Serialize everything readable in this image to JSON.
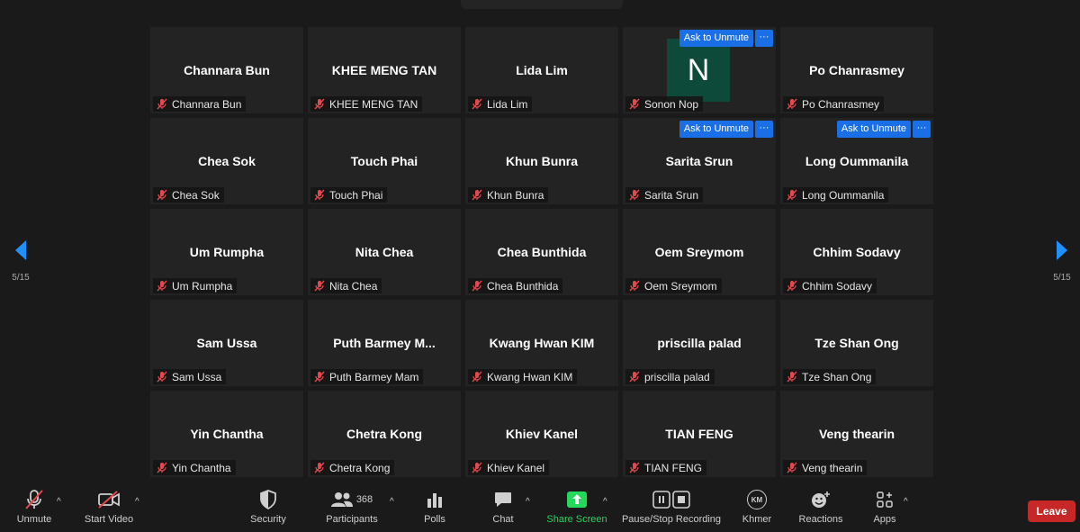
{
  "gallery": {
    "page_indicator_left": "5/15",
    "page_indicator_right": "5/15",
    "ask_to_unmute_label": "Ask to Unmute",
    "more_label": "···",
    "tiles": [
      {
        "name": "Channara Bun",
        "label": "Channara Bun"
      },
      {
        "name": "KHEE MENG TAN",
        "label": "KHEE MENG TAN"
      },
      {
        "name": "Lida Lim",
        "label": "Lida Lim"
      },
      {
        "name": "",
        "label": "Sonon Nop",
        "avatar_letter": "N",
        "ask_unmute": true
      },
      {
        "name": "Po Chanrasmey",
        "label": "Po Chanrasmey"
      },
      {
        "name": "Chea Sok",
        "label": "Chea Sok"
      },
      {
        "name": "Touch Phai",
        "label": "Touch Phai"
      },
      {
        "name": "Khun Bunra",
        "label": "Khun Bunra"
      },
      {
        "name": "Sarita Srun",
        "label": "Sarita Srun",
        "ask_unmute": true
      },
      {
        "name": "Long Oummanila",
        "label": "Long Oummanila",
        "ask_unmute": true
      },
      {
        "name": "Um Rumpha",
        "label": "Um Rumpha"
      },
      {
        "name": "Nita Chea",
        "label": "Nita Chea"
      },
      {
        "name": "Chea Bunthida",
        "label": "Chea Bunthida"
      },
      {
        "name": "Oem Sreymom",
        "label": "Oem Sreymom"
      },
      {
        "name": "Chhim Sodavy",
        "label": "Chhim Sodavy"
      },
      {
        "name": "Sam Ussa",
        "label": "Sam Ussa"
      },
      {
        "name": "Puth Barmey M...",
        "label": "Puth Barmey Mam"
      },
      {
        "name": "Kwang Hwan KIM",
        "label": "Kwang Hwan KIM"
      },
      {
        "name": "priscilla palad",
        "label": "priscilla palad"
      },
      {
        "name": "Tze Shan Ong",
        "label": "Tze Shan Ong"
      },
      {
        "name": "Yin Chantha",
        "label": "Yin Chantha"
      },
      {
        "name": "Chetra Kong",
        "label": "Chetra Kong"
      },
      {
        "name": "Khiev Kanel",
        "label": "Khiev Kanel"
      },
      {
        "name": "TIAN FENG",
        "label": "TIAN FENG"
      },
      {
        "name": "Veng thearin",
        "label": "Veng thearin"
      }
    ]
  },
  "toolbar": {
    "unmute": "Unmute",
    "start_video": "Start Video",
    "security": "Security",
    "participants": "Participants",
    "participant_count": "368",
    "polls": "Polls",
    "chat": "Chat",
    "share_screen": "Share Screen",
    "recording": "Pause/Stop Recording",
    "language": "Khmer",
    "language_badge": "KM",
    "reactions": "Reactions",
    "apps": "Apps",
    "leave": "Leave",
    "caret": "^"
  },
  "colors": {
    "background": "#1a1a1a",
    "tile": "#232323",
    "accent_blue": "#1a6fe6",
    "share_green": "#23d959",
    "leave_red": "#c62828",
    "muted_red": "#e5484d",
    "avatar_green": "#0e4a3a"
  }
}
